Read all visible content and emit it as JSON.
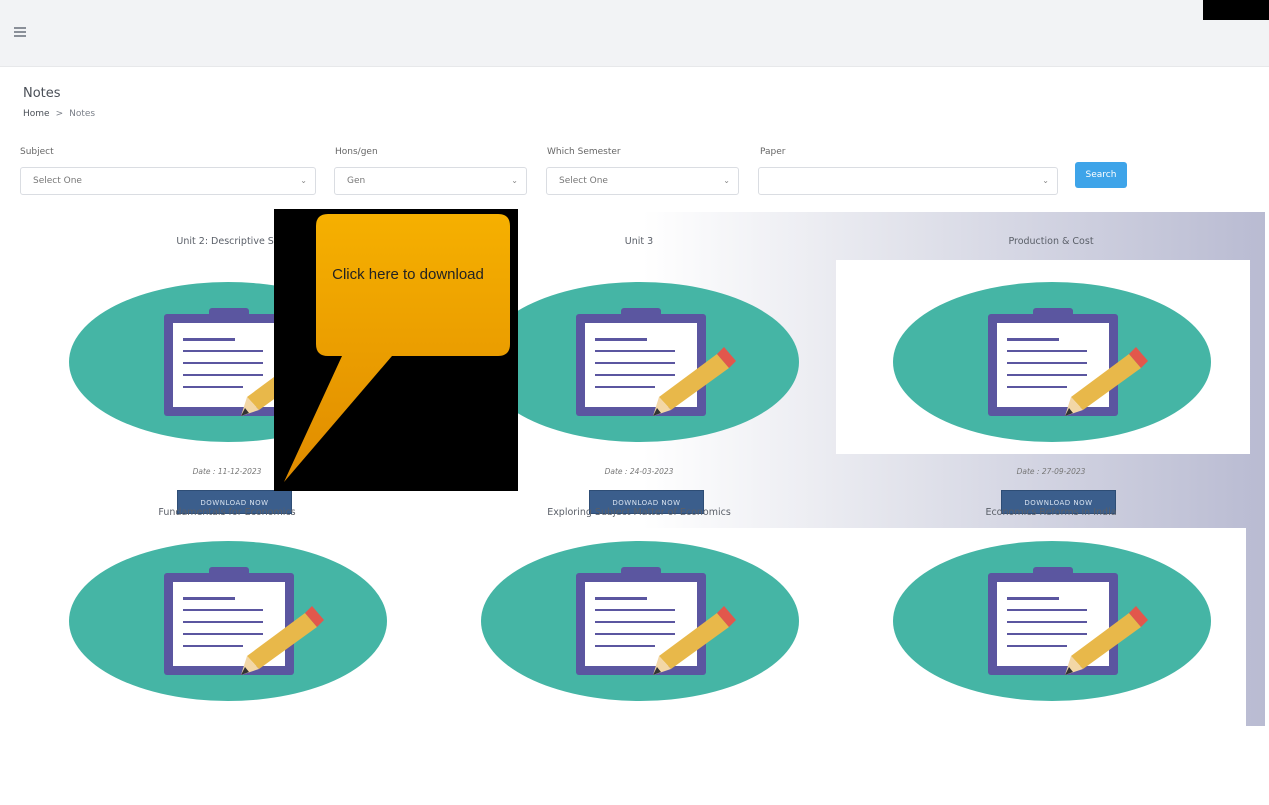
{
  "header": {
    "menu_icon": "hamburger-icon"
  },
  "page": {
    "title": "Notes",
    "breadcrumb": {
      "home": "Home",
      "separator": ">",
      "current": "Notes"
    }
  },
  "filters": {
    "subject": {
      "label": "Subject",
      "value": "Select One"
    },
    "hons_gen": {
      "label": "Hons/gen",
      "value": "Gen"
    },
    "semester": {
      "label": "Which Semester",
      "value": "Select One"
    },
    "paper": {
      "label": "Paper",
      "value": ""
    },
    "search_label": "Search"
  },
  "notes": [
    {
      "title": "Unit 2: Descriptive St",
      "date": "Date : 11-12-2023",
      "button": "DOWNLOAD NOW"
    },
    {
      "title": "Unit 3",
      "date": "Date : 24-03-2023",
      "button": "DOWNLOAD NOW"
    },
    {
      "title": "Production & Cost",
      "date": "Date : 27-09-2023",
      "button": "DOWNLOAD NOW"
    },
    {
      "title": "Fundamentals for Economics",
      "date": "",
      "button": ""
    },
    {
      "title": "Exploring Subject Matter of Economics",
      "date": "",
      "button": ""
    },
    {
      "title": "Economics Reforms in India",
      "date": "",
      "button": ""
    }
  ],
  "callout": {
    "text": "Click here to download"
  },
  "colors": {
    "accent": "#3ea4e9",
    "button": "#3b5e8c",
    "oval": "#45b5a5",
    "clipboard": "#5b56a0",
    "callout": "#f2a600"
  }
}
